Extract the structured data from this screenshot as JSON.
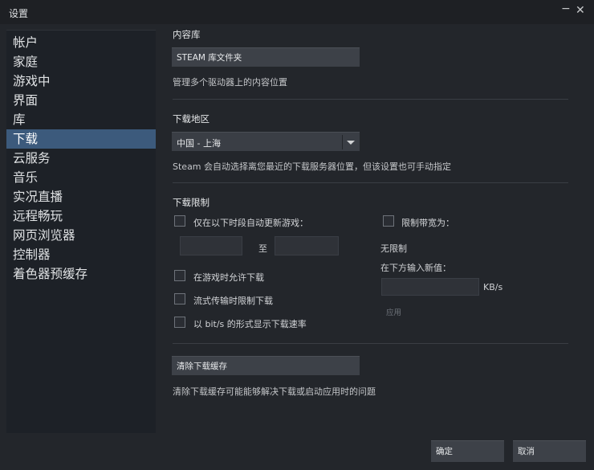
{
  "window": {
    "title": "设置",
    "minimize": "−",
    "close": "✕"
  },
  "sidebar": {
    "items": [
      {
        "label": "帐户"
      },
      {
        "label": "家庭"
      },
      {
        "label": "游戏中"
      },
      {
        "label": "界面"
      },
      {
        "label": "库"
      },
      {
        "label": "下载",
        "active": true
      },
      {
        "label": "云服务"
      },
      {
        "label": "音乐"
      },
      {
        "label": "实况直播"
      },
      {
        "label": "远程畅玩"
      },
      {
        "label": "网页浏览器"
      },
      {
        "label": "控制器"
      },
      {
        "label": "着色器预缓存"
      }
    ]
  },
  "content_library": {
    "title": "内容库",
    "button": "STEAM 库文件夹",
    "desc": "管理多个驱动器上的内容位置"
  },
  "download_region": {
    "title": "下载地区",
    "selected": "中国 - 上海",
    "desc": "Steam 会自动选择离您最近的下载服务器位置，但该设置也可手动指定"
  },
  "download_limits": {
    "title": "下载限制",
    "auto_update_window_label": "仅在以下时段自动更新游戏：",
    "range_separator": "至",
    "allow_while_playing_label": "在游戏时允许下载",
    "throttle_while_streaming_label": "流式传输时限制下载",
    "show_bits_label": "以 bit/s 的形式显示下载速率",
    "limit_bandwidth_label": "限制带宽为：",
    "no_limit": "无限制",
    "enter_new_value": "在下方输入新值：",
    "unit": "KB/s",
    "apply": "应用"
  },
  "download_cache": {
    "button": "清除下载缓存",
    "desc": "清除下载缓存可能能够解决下载或启动应用时的问题"
  },
  "footer": {
    "ok": "确定",
    "cancel": "取消"
  },
  "colors": {
    "background": "#23262b",
    "sidebar": "#1d2127",
    "selected": "#3c5a7c",
    "button": "#3d4148"
  }
}
